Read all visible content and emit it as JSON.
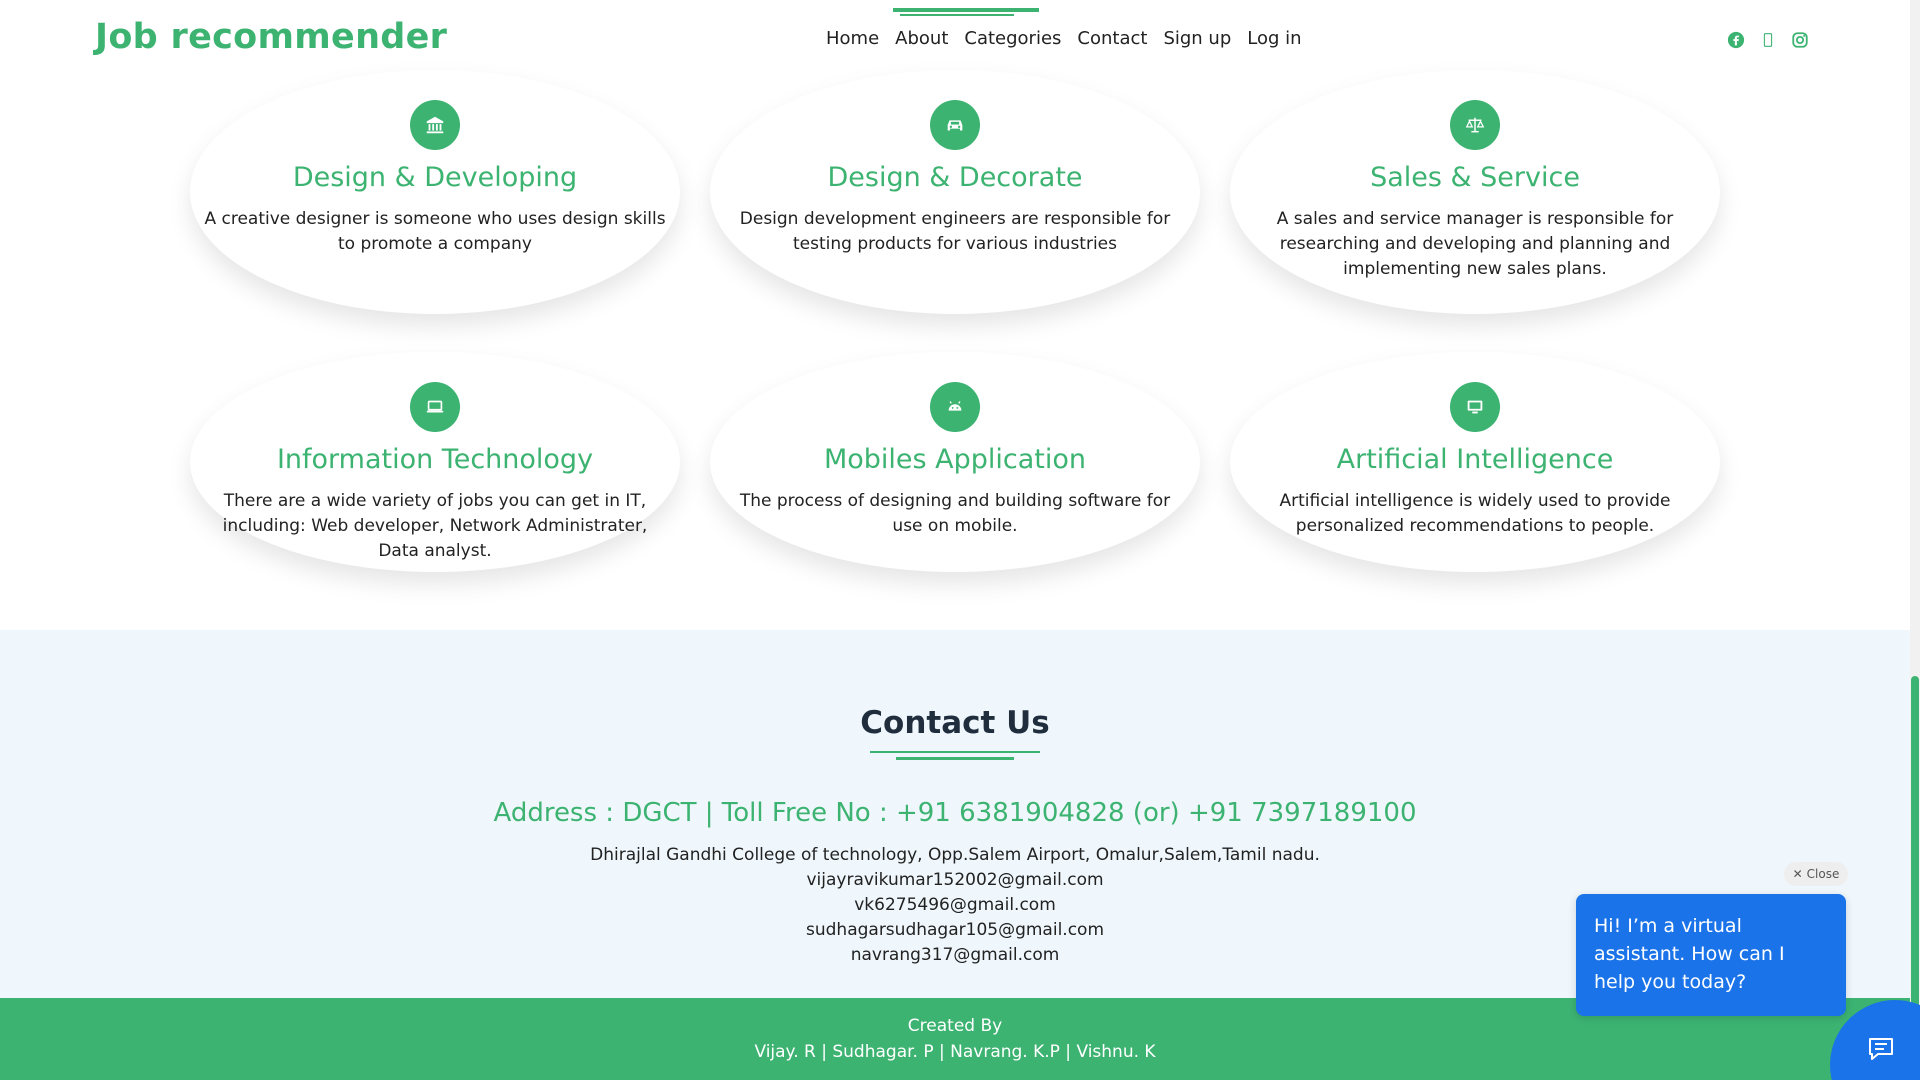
{
  "header": {
    "brand": "Job recommender",
    "nav": [
      "Home",
      "About",
      "Categories",
      "Contact",
      "Sign up",
      "Log in"
    ],
    "social_icons": [
      "facebook-icon",
      "twitter-icon",
      "instagram-icon"
    ]
  },
  "services": [
    {
      "icon": "bank-icon",
      "title": "Design & Developing",
      "desc": "A creative designer is someone who uses design skills to promote a company"
    },
    {
      "icon": "car-icon",
      "title": "Design & Decorate",
      "desc": "Design development engineers are responsible for testing products for various industries"
    },
    {
      "icon": "balance-scale-icon",
      "title": "Sales & Service",
      "desc": "A sales and service manager is responsible for researching and developing and planning and implementing new sales plans."
    },
    {
      "icon": "laptop-icon",
      "title": "Information Technology",
      "desc": "There are a wide variety of jobs you can get in IT, including: Web developer, Network Administrater, Data analyst."
    },
    {
      "icon": "android-icon",
      "title": "Mobiles Application",
      "desc": "The process of designing and building software for use on mobile."
    },
    {
      "icon": "monitor-icon",
      "title": "Artificial Intelligence",
      "desc": "Artificial intelligence is widely used to provide personalized recommendations to people."
    }
  ],
  "contact": {
    "heading": "Contact Us",
    "address": "Address : DGCT | Toll Free No : +91 6381904828 (or) +91 7397189100",
    "lines": [
      "Dhirajlal Gandhi College of technology, Opp.Salem Airport, Omalur,Salem,Tamil nadu.",
      "vijayravikumar152002@gmail.com",
      "vk6275496@gmail.com",
      "sudhagarsudhagar105@gmail.com",
      "navrang317@gmail.com"
    ]
  },
  "footer": {
    "created_by": "Created By",
    "names": "Vijay. R | Sudhagar. P | Navrang. K.P | Vishnu. K"
  },
  "chat": {
    "close_label": "Close",
    "message": "Hi! I’m a virtual assistant. How can I help you today?"
  },
  "colors": {
    "accent": "#3cb371",
    "chat": "#1a73e8",
    "contact_bg": "#eff7fc"
  }
}
